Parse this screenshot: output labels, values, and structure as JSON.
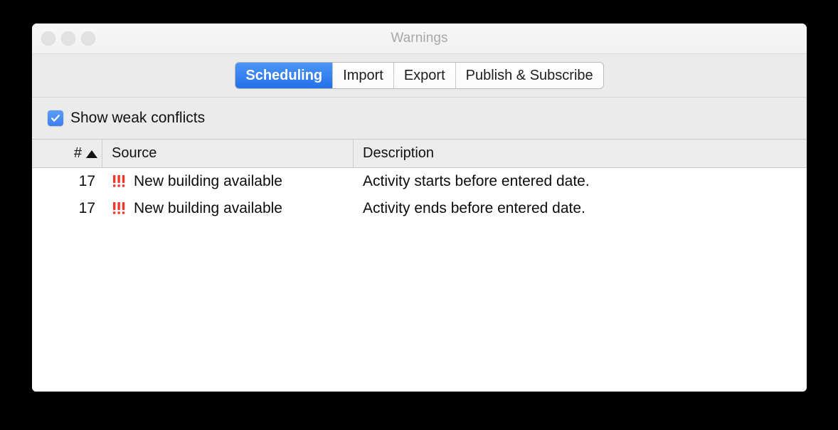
{
  "window": {
    "title": "Warnings",
    "traffic_lights": [
      {
        "name": "close",
        "color": "#e2e2e2"
      },
      {
        "name": "minimize",
        "color": "#e2e2e2"
      },
      {
        "name": "zoom",
        "color": "#e2e2e2"
      }
    ]
  },
  "tabs": {
    "items": [
      {
        "label": "Scheduling",
        "selected": true
      },
      {
        "label": "Import",
        "selected": false
      },
      {
        "label": "Export",
        "selected": false
      },
      {
        "label": "Publish & Subscribe",
        "selected": false
      }
    ],
    "selected_color": "#3d80ef"
  },
  "options": {
    "show_weak_conflicts": {
      "label": "Show weak conflicts",
      "checked": true,
      "checkmark": "✓"
    }
  },
  "table": {
    "columns": [
      {
        "key": "num",
        "label": "#",
        "sort": "ascending",
        "sort_glyph": "▲"
      },
      {
        "key": "source",
        "label": "Source"
      },
      {
        "key": "description",
        "label": "Description"
      }
    ],
    "rows": [
      {
        "num": "17",
        "severity_icon": "triple-exclamation-icon",
        "severity_color": "#f4372a",
        "source": "New building available",
        "description": "Activity starts before entered date."
      },
      {
        "num": "17",
        "severity_icon": "triple-exclamation-icon",
        "severity_color": "#f4372a",
        "source": "New building available",
        "description": "Activity ends before entered date."
      }
    ]
  }
}
